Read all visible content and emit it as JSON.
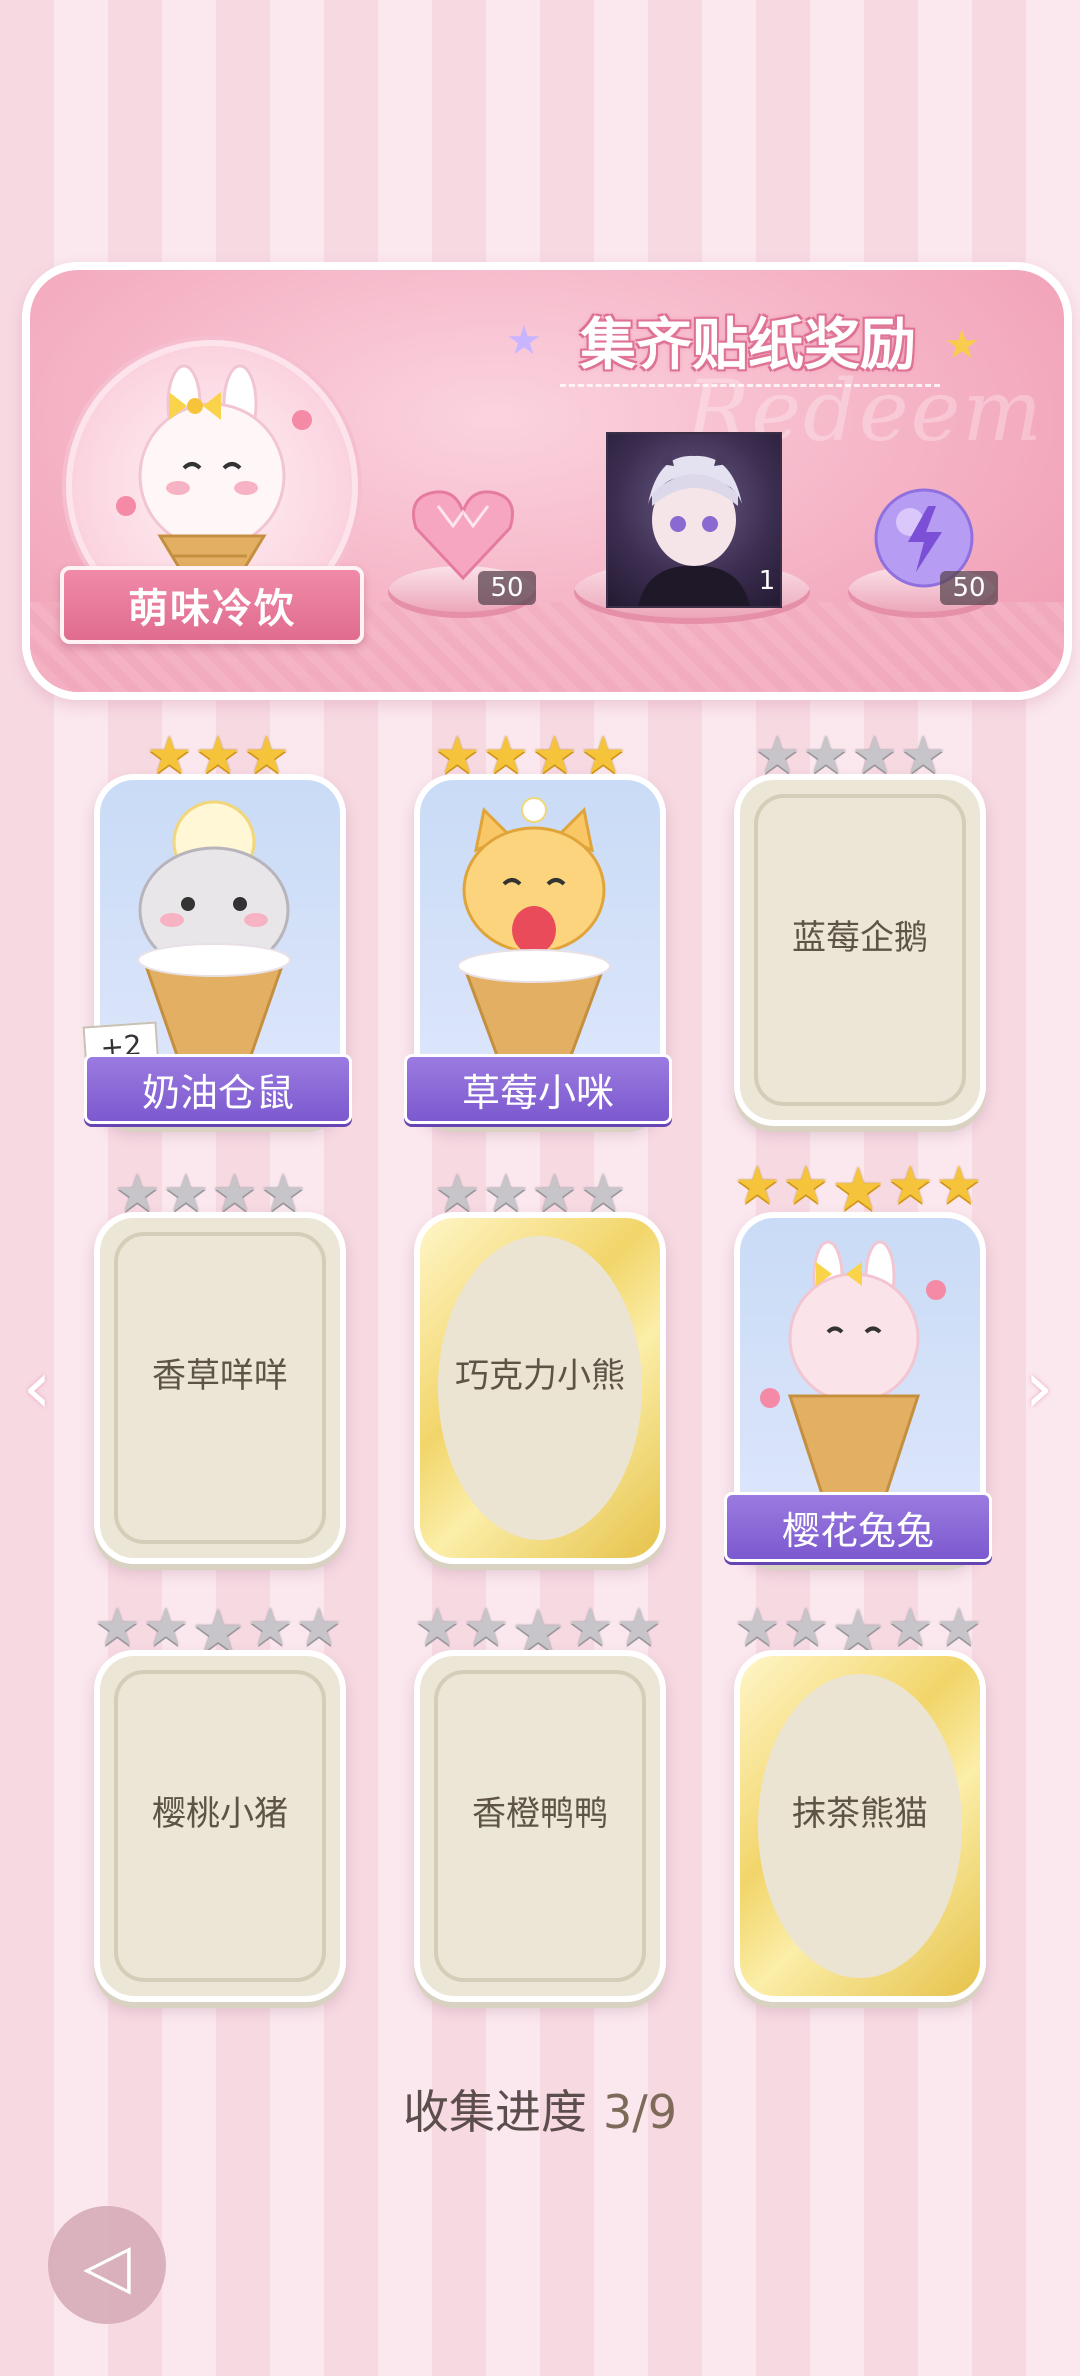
{
  "banner": {
    "title": "集齐贴纸奖励",
    "watermark": "Redeem",
    "book_name": "萌味冷饮",
    "rewards": [
      {
        "icon": "pink-heart-gem-icon",
        "count": "50"
      },
      {
        "icon": "character-portrait",
        "count": "1"
      },
      {
        "icon": "purple-lightning-orb-icon",
        "count": "50"
      }
    ]
  },
  "cards": [
    {
      "name": "奶油仓鼠",
      "stars": 3,
      "collected": true,
      "badge": "+2",
      "art": "hamster-icecream"
    },
    {
      "name": "草莓小咪",
      "stars": 4,
      "collected": true,
      "art": "cat-icecream"
    },
    {
      "name": "蓝莓企鹅",
      "stars": 4,
      "collected": false,
      "gold": false
    },
    {
      "name": "香草咩咩",
      "stars": 4,
      "collected": false,
      "gold": false
    },
    {
      "name": "巧克力小熊",
      "stars": 4,
      "collected": false,
      "gold": true
    },
    {
      "name": "樱花兔兔",
      "stars": 5,
      "collected": true,
      "art": "bunny-icecream"
    },
    {
      "name": "樱桃小猪",
      "stars": 5,
      "collected": false,
      "gold": false
    },
    {
      "name": "香橙鸭鸭",
      "stars": 5,
      "collected": false,
      "gold": false
    },
    {
      "name": "抹茶熊猫",
      "stars": 5,
      "collected": false,
      "gold": true
    }
  ],
  "progress": {
    "label": "收集进度",
    "value": "3/9"
  },
  "colors": {
    "star_gold": "#f6c43b",
    "star_grey": "#c7c5c9",
    "name_band": "#8a68d8",
    "accent_pink": "#ef98b0"
  }
}
